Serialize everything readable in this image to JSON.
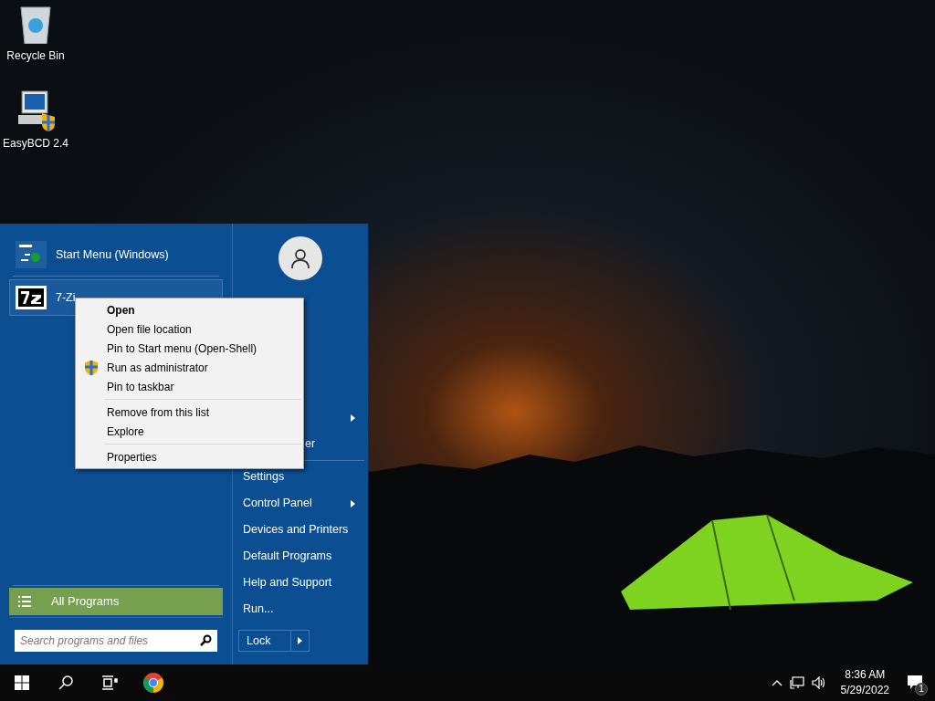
{
  "desktop_icons": [
    {
      "label": "Recycle Bin",
      "kind": "bin"
    },
    {
      "label": "EasyBCD 2.4",
      "kind": "app"
    }
  ],
  "start_menu": {
    "programs": [
      {
        "label": "Start Menu (Windows)",
        "kind": "start",
        "selected": false
      },
      {
        "label": "7-Zi",
        "kind": "zip",
        "selected": true
      }
    ],
    "all_programs": "All Programs",
    "search": {
      "placeholder": "Search programs and files"
    },
    "right_items": [
      {
        "kind": "hidden",
        "submenu": true
      },
      {
        "kind": "clipped",
        "label": "er",
        "submenu": false
      },
      {
        "kind": "separator"
      },
      {
        "kind": "item",
        "label": "Settings",
        "submenu": false
      },
      {
        "kind": "item",
        "label": "Control Panel",
        "submenu": true
      },
      {
        "kind": "item",
        "label": "Devices and Printers",
        "submenu": false
      },
      {
        "kind": "item",
        "label": "Default Programs",
        "submenu": false
      },
      {
        "kind": "item",
        "label": "Help and Support",
        "submenu": false
      },
      {
        "kind": "item",
        "label": "Run...",
        "submenu": false
      }
    ],
    "shutdown_button": "Lock"
  },
  "context_menu": [
    {
      "kind": "item",
      "label": "Open",
      "default": true,
      "has_icon": false
    },
    {
      "kind": "item",
      "label": "Open file location",
      "default": false,
      "has_icon": false
    },
    {
      "kind": "item",
      "label": "Pin to Start menu (Open-Shell)",
      "default": false,
      "has_icon": false
    },
    {
      "kind": "item",
      "label": "Run as administrator",
      "default": false,
      "has_icon": true
    },
    {
      "kind": "item",
      "label": "Pin to taskbar",
      "default": false,
      "has_icon": false
    },
    {
      "kind": "separator"
    },
    {
      "kind": "item",
      "label": "Remove from this list",
      "default": false,
      "has_icon": false
    },
    {
      "kind": "item",
      "label": "Explore",
      "default": false,
      "has_icon": false
    },
    {
      "kind": "separator"
    },
    {
      "kind": "item",
      "label": "Properties",
      "default": false,
      "has_icon": false
    }
  ],
  "taskbar": {
    "time": "8:36 AM",
    "date": "5/29/2022",
    "notification_count": "1"
  }
}
